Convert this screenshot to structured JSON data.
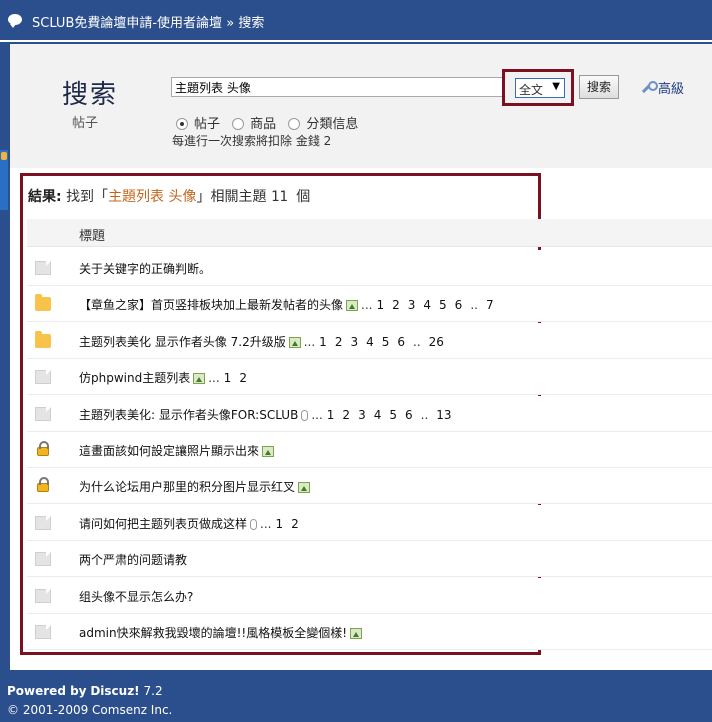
{
  "topbar": {
    "icon": "speech-bubble-icon",
    "forum_name": "SCLUB免費論壇申請-使用者論壇",
    "separator": "»",
    "current": "搜索"
  },
  "search": {
    "title": "搜索",
    "subtitle": "帖子",
    "query": "主題列表 头像",
    "scope_selected": "全文",
    "submit_label": "搜索",
    "advanced_label": "高級",
    "types": [
      {
        "label": "帖子",
        "checked": true
      },
      {
        "label": "商品",
        "checked": false
      },
      {
        "label": "分類信息",
        "checked": false
      }
    ],
    "cost_note": "每進行一次搜索將扣除 金錢 2"
  },
  "results": {
    "label": "結果:",
    "found_prefix": "找到「",
    "keyword": "主題列表 头像",
    "found_suffix": "」相關主題",
    "count": "11 個",
    "column_title": "標題",
    "rows": [
      {
        "icon": "document-icon",
        "title": "关于关键字的正确判断。",
        "image": false,
        "clip": false,
        "pages": []
      },
      {
        "icon": "folder-icon",
        "title": "【章鱼之家】首页竖排板块加上最新发帖者的头像",
        "image": true,
        "clip": false,
        "ellipsis": "...",
        "pages": [
          "1",
          "2",
          "3",
          "4",
          "5",
          "6",
          "..",
          "7"
        ]
      },
      {
        "icon": "folder-icon",
        "title": "主题列表美化 显示作者头像 7.2升级版",
        "image": true,
        "clip": false,
        "ellipsis": "...",
        "pages": [
          "1",
          "2",
          "3",
          "4",
          "5",
          "6",
          "..",
          "26"
        ]
      },
      {
        "icon": "document-icon",
        "title": "仿phpwind主题列表",
        "image": true,
        "clip": false,
        "ellipsis": "...",
        "pages": [
          "1",
          "2"
        ]
      },
      {
        "icon": "document-icon",
        "title": "主題列表美化: 显示作者头像FOR:SCLUB",
        "image": false,
        "clip": true,
        "ellipsis": "...",
        "pages": [
          "1",
          "2",
          "3",
          "4",
          "5",
          "6",
          "..",
          "13"
        ]
      },
      {
        "icon": "lock-icon",
        "title": "這畫面該如何設定讓照片顯示出來",
        "image": true,
        "clip": false,
        "pages": []
      },
      {
        "icon": "lock-icon",
        "title": "为什么论坛用户那里的积分图片显示红叉",
        "image": true,
        "clip": false,
        "pages": []
      },
      {
        "icon": "document-icon",
        "title": "请问如何把主题列表页做成这样",
        "image": false,
        "clip": true,
        "ellipsis": "...",
        "pages": [
          "1",
          "2"
        ]
      },
      {
        "icon": "document-icon",
        "title": "两个严肃的问题请教",
        "image": false,
        "clip": false,
        "pages": []
      },
      {
        "icon": "document-icon",
        "title": "组头像不显示怎么办?",
        "image": false,
        "clip": false,
        "pages": []
      },
      {
        "icon": "document-icon",
        "title": "admin快來解救我毀壞的論壇!!風格模板全變個樣!",
        "image": true,
        "clip": false,
        "pages": []
      }
    ]
  },
  "footer": {
    "powered_prefix": "Powered by",
    "product": "Discuz!",
    "version": "7.2",
    "copyright": "© 2001-2009 Comsenz Inc."
  },
  "colors": {
    "header_blue": "#2b4e8c",
    "highlight_border": "#7a1020",
    "keyword_orange": "#c3661c"
  }
}
